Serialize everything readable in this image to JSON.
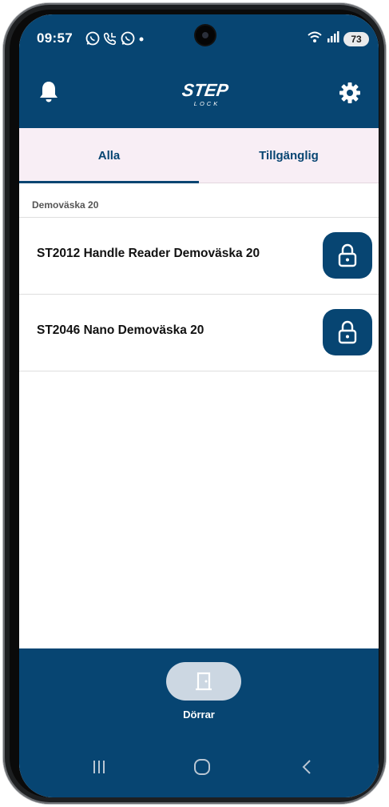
{
  "status_bar": {
    "time": "09:57",
    "notification_icons": [
      "whatsapp-icon",
      "whatsapp-call-icon",
      "whatsapp-icon"
    ],
    "battery": "73"
  },
  "app": {
    "logo_text": "STEP",
    "logo_subtext": "LOCK",
    "colors": {
      "primary": "#074572",
      "tab_bg": "#f8eef5",
      "nav_pill": "#ccd7e2"
    }
  },
  "tabs": [
    {
      "label": "Alla",
      "active": true
    },
    {
      "label": "Tillgänglig",
      "active": false
    }
  ],
  "section": {
    "title": "Demoväska 20"
  },
  "doors": [
    {
      "name": "ST2012 Handle Reader Demoväska 20",
      "action_icon": "lock-icon"
    },
    {
      "name": "ST2046 Nano Demoväska 20",
      "action_icon": "lock-icon"
    }
  ],
  "bottom_nav": {
    "items": [
      {
        "label": "Dörrar",
        "icon": "door-icon",
        "active": true
      }
    ]
  }
}
